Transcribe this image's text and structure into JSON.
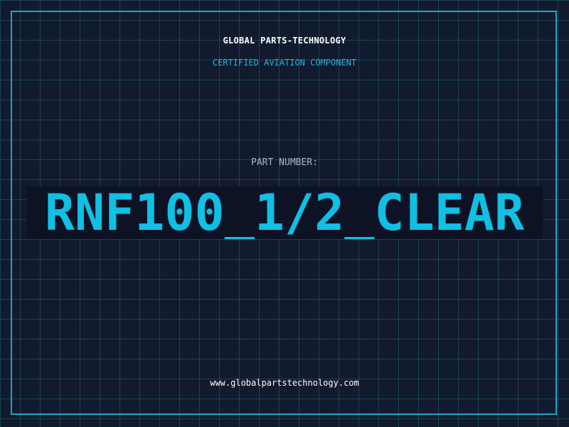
{
  "header": {
    "company": "GLOBAL PARTS-TECHNOLOGY",
    "tagline": "CERTIFIED AVIATION COMPONENT"
  },
  "part": {
    "label": "PART NUMBER:",
    "number": "RNF100_1/2_CLEAR"
  },
  "footer": {
    "website": "www.globalpartstechnology.com"
  },
  "colors": {
    "background": "#121a2e",
    "grid": "#2882a0",
    "accent": "#10bfe3",
    "frame": "#19a6c9"
  }
}
